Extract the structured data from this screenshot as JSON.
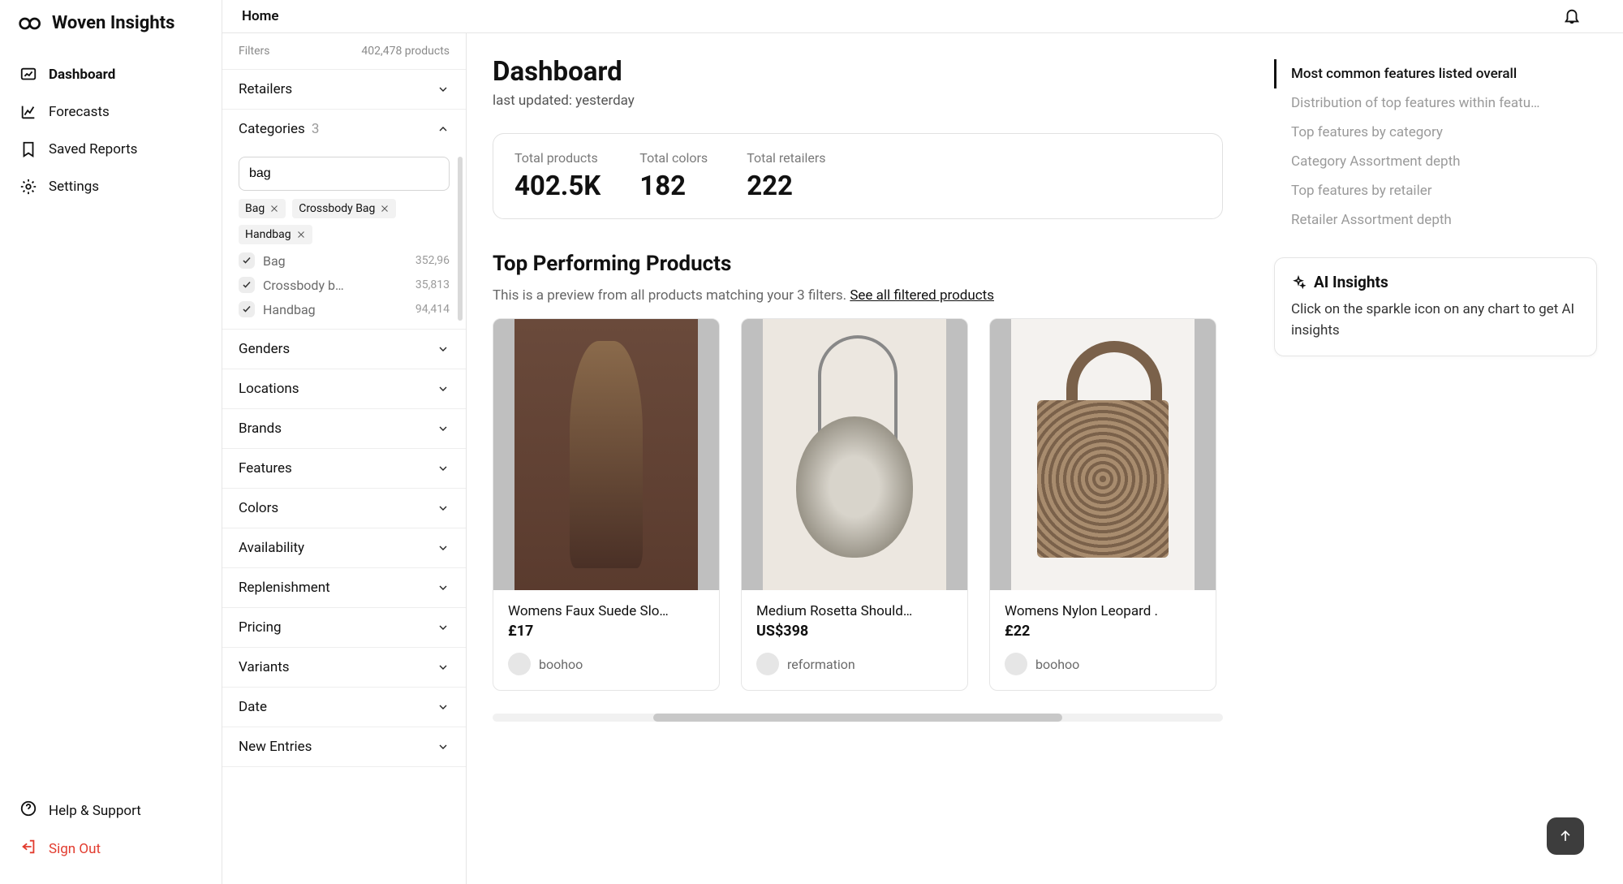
{
  "brand": "Woven Insights",
  "header": {
    "breadcrumb": "Home"
  },
  "nav": {
    "items": [
      {
        "label": "Dashboard",
        "icon": "dashboard-icon",
        "active": true
      },
      {
        "label": "Forecasts",
        "icon": "chart-icon",
        "active": false
      },
      {
        "label": "Saved Reports",
        "icon": "bookmark-icon",
        "active": false
      },
      {
        "label": "Settings",
        "icon": "gear-icon",
        "active": false
      }
    ],
    "help": "Help & Support",
    "signout": "Sign Out"
  },
  "filters": {
    "title": "Filters",
    "summary": "402,478 products",
    "sections": [
      {
        "label": "Retailers",
        "expanded": false
      },
      {
        "label": "Categories",
        "expanded": true,
        "count": "3"
      },
      {
        "label": "Genders",
        "expanded": false
      },
      {
        "label": "Locations",
        "expanded": false
      },
      {
        "label": "Brands",
        "expanded": false
      },
      {
        "label": "Features",
        "expanded": false
      },
      {
        "label": "Colors",
        "expanded": false
      },
      {
        "label": "Availability",
        "expanded": false
      },
      {
        "label": "Replenishment",
        "expanded": false
      },
      {
        "label": "Pricing",
        "expanded": false
      },
      {
        "label": "Variants",
        "expanded": false
      },
      {
        "label": "Date",
        "expanded": false
      },
      {
        "label": "New Entries",
        "expanded": false
      }
    ],
    "categories": {
      "search": "bag",
      "chips": [
        "Bag",
        "Crossbody Bag",
        "Handbag"
      ],
      "options": [
        {
          "label": "Bag",
          "count": "352,96",
          "checked": true
        },
        {
          "label": "Crossbody b…",
          "count": "35,813",
          "checked": true
        },
        {
          "label": "Handbag",
          "count": "94,414",
          "checked": true
        }
      ]
    }
  },
  "dashboard": {
    "title": "Dashboard",
    "updated": "last updated: yesterday",
    "stats": [
      {
        "label": "Total products",
        "value": "402.5K"
      },
      {
        "label": "Total colors",
        "value": "182"
      },
      {
        "label": "Total retailers",
        "value": "222"
      }
    ],
    "top_title": "Top Performing Products",
    "preview_prefix": "This is a preview from all products matching your 3 filters. ",
    "preview_link": "See all filtered products",
    "products": [
      {
        "name": "Womens Faux Suede Slo…",
        "price": "£17",
        "retailer": "boohoo"
      },
      {
        "name": "Medium Rosetta Should…",
        "price": "US$398",
        "retailer": "reformation"
      },
      {
        "name": "Womens Nylon Leopard .",
        "price": "£22",
        "retailer": "boohoo"
      }
    ]
  },
  "toc": [
    {
      "label": "Most common features listed overall",
      "active": true
    },
    {
      "label": "Distribution of top features within featu…",
      "active": false
    },
    {
      "label": "Top features by category",
      "active": false
    },
    {
      "label": "Category Assortment depth",
      "active": false
    },
    {
      "label": "Top features by retailer",
      "active": false
    },
    {
      "label": "Retailer Assortment depth",
      "active": false
    }
  ],
  "ai": {
    "title": "AI Insights",
    "body": "Click on the sparkle icon on any chart to get AI insights"
  }
}
